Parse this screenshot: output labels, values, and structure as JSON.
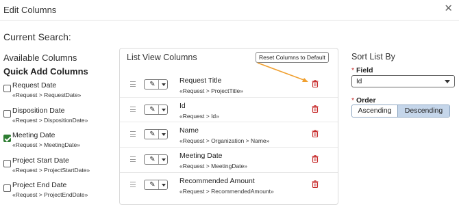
{
  "header": {
    "title": "Edit Columns",
    "close_icon": "close-icon"
  },
  "current_search_label": "Current Search:",
  "available": {
    "title": "Available Columns",
    "quick_add_title": "Quick Add Columns",
    "items": [
      {
        "label": "Request Date",
        "path": "«Request > RequestDate»",
        "checked": false
      },
      {
        "label": "Disposition Date",
        "path": "«Request > DispositionDate»",
        "checked": false
      },
      {
        "label": "Meeting Date",
        "path": "«Request > MeetingDate»",
        "checked": true
      },
      {
        "label": "Project Start Date",
        "path": "«Request > ProjectStartDate»",
        "checked": false
      },
      {
        "label": "Project End Date",
        "path": "«Request > ProjectEndDate»",
        "checked": false
      }
    ]
  },
  "list_view": {
    "title": "List View Columns",
    "reset_label": "Reset Columns to Default",
    "rows": [
      {
        "label": "Request Title",
        "path": "«Request > ProjectTitle»"
      },
      {
        "label": "Id",
        "path": "«Request > Id»"
      },
      {
        "label": "Name",
        "path": "«Request > Organization > Name»"
      },
      {
        "label": "Meeting Date",
        "path": "«Request > MeetingDate»"
      },
      {
        "label": "Recommended Amount",
        "path": "«Request > RecommendedAmount»"
      }
    ]
  },
  "sort": {
    "title": "Sort List By",
    "required_mark": "*",
    "field_label": "Field",
    "field_value": "Id",
    "order_label": "Order",
    "ascending": "Ascending",
    "descending": "Descending",
    "selected_order": "Descending"
  },
  "colors": {
    "trash": "#c62828",
    "arrow": "#f0a030",
    "checked": "#2e7d32",
    "selected_order_bg": "#c5d6ea"
  }
}
